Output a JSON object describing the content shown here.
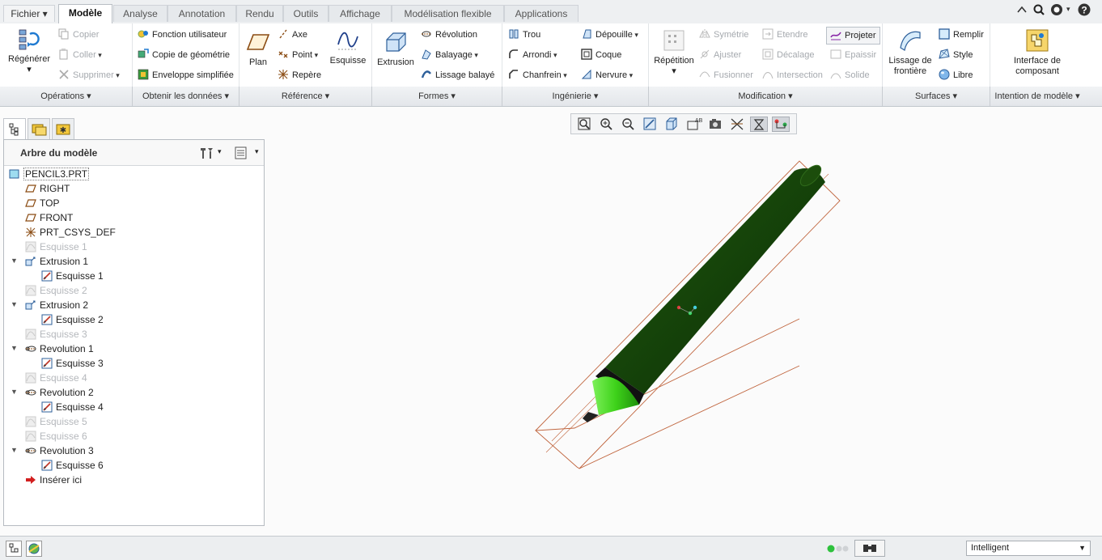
{
  "tabs": {
    "file": "Fichier",
    "items": [
      "Modèle",
      "Analyse",
      "Annotation",
      "Rendu",
      "Outils",
      "Affichage",
      "Modélisation flexible",
      "Applications"
    ]
  },
  "ribbon": {
    "operations": {
      "regenerer": "Régénérer",
      "copier": "Copier",
      "coller": "Coller",
      "supprimer": "Supprimer"
    },
    "obtenir": {
      "fonction": "Fonction utilisateur",
      "copie": "Copie de géométrie",
      "enveloppe": "Enveloppe simplifiée"
    },
    "reference": {
      "plan": "Plan",
      "axe": "Axe",
      "point": "Point",
      "repere": "Repère",
      "esquisse": "Esquisse"
    },
    "formes": {
      "extrusion": "Extrusion",
      "revolution": "Révolution",
      "balayage": "Balayage",
      "lissage": "Lissage balayé"
    },
    "ingenierie": {
      "trou": "Trou",
      "arrondi": "Arrondi",
      "chanfrein": "Chanfrein",
      "depouille": "Dépouille",
      "coque": "Coque",
      "nervure": "Nervure"
    },
    "modification": {
      "repetition": "Répétition",
      "symetrie": "Symétrie",
      "ajuster": "Ajuster",
      "fusionner": "Fusionner",
      "etendre": "Etendre",
      "decalage": "Décalage",
      "intersection": "Intersection",
      "projeter": "Projeter",
      "epaissir": "Epaissir",
      "solide": "Solide"
    },
    "surfaces": {
      "lissage_l1": "Lissage de",
      "lissage_l2": "frontière",
      "remplir": "Remplir",
      "style": "Style",
      "libre": "Libre"
    },
    "intention": {
      "interface_l1": "Interface de",
      "interface_l2": "composant"
    }
  },
  "groups": {
    "operations": "Opérations",
    "obtenir": "Obtenir les données",
    "reference": "Référence",
    "formes": "Formes",
    "ingenierie": "Ingénierie",
    "modification": "Modification",
    "surfaces": "Surfaces",
    "intention": "Intention de modèle"
  },
  "tree": {
    "title": "Arbre du modèle",
    "items": [
      {
        "label": "PENCIL3.PRT",
        "icon": "part-icon",
        "dim": false
      },
      {
        "label": "RIGHT",
        "icon": "datum-plane-icon",
        "dim": false
      },
      {
        "label": "TOP",
        "icon": "datum-plane-icon",
        "dim": false
      },
      {
        "label": "FRONT",
        "icon": "datum-plane-icon",
        "dim": false
      },
      {
        "label": "PRT_CSYS_DEF",
        "icon": "csys-icon",
        "dim": false
      },
      {
        "label": "Esquisse 1",
        "icon": "sketch-hidden-icon",
        "dim": true
      },
      {
        "label": "Extrusion 1",
        "icon": "extrude-icon",
        "dim": false
      },
      {
        "label": "Esquisse 1",
        "icon": "sketch-icon",
        "dim": false
      },
      {
        "label": "Esquisse 2",
        "icon": "sketch-hidden-icon",
        "dim": true
      },
      {
        "label": "Extrusion 2",
        "icon": "extrude-icon",
        "dim": false
      },
      {
        "label": "Esquisse 2",
        "icon": "sketch-icon",
        "dim": false
      },
      {
        "label": "Esquisse 3",
        "icon": "sketch-hidden-icon",
        "dim": true
      },
      {
        "label": "Revolution 1",
        "icon": "revolve-icon",
        "dim": false
      },
      {
        "label": "Esquisse 3",
        "icon": "sketch-icon",
        "dim": false
      },
      {
        "label": "Esquisse 4",
        "icon": "sketch-hidden-icon",
        "dim": true
      },
      {
        "label": "Revolution 2",
        "icon": "revolve-icon",
        "dim": false
      },
      {
        "label": "Esquisse 4",
        "icon": "sketch-icon",
        "dim": false
      },
      {
        "label": "Esquisse 5",
        "icon": "sketch-hidden-icon",
        "dim": true
      },
      {
        "label": "Esquisse 6",
        "icon": "sketch-hidden-icon",
        "dim": true
      },
      {
        "label": "Revolution 3",
        "icon": "revolve-icon",
        "dim": false
      },
      {
        "label": "Esquisse 6",
        "icon": "sketch-icon",
        "dim": false
      },
      {
        "label": "Insérer ici",
        "icon": "insert-arrow-icon",
        "dim": false
      }
    ]
  },
  "status": {
    "filter": "Intelligent"
  },
  "colors": {
    "accent": "#1f7ad1",
    "body_green": "#1c4d0c",
    "tip_green": "#3ed21a"
  }
}
